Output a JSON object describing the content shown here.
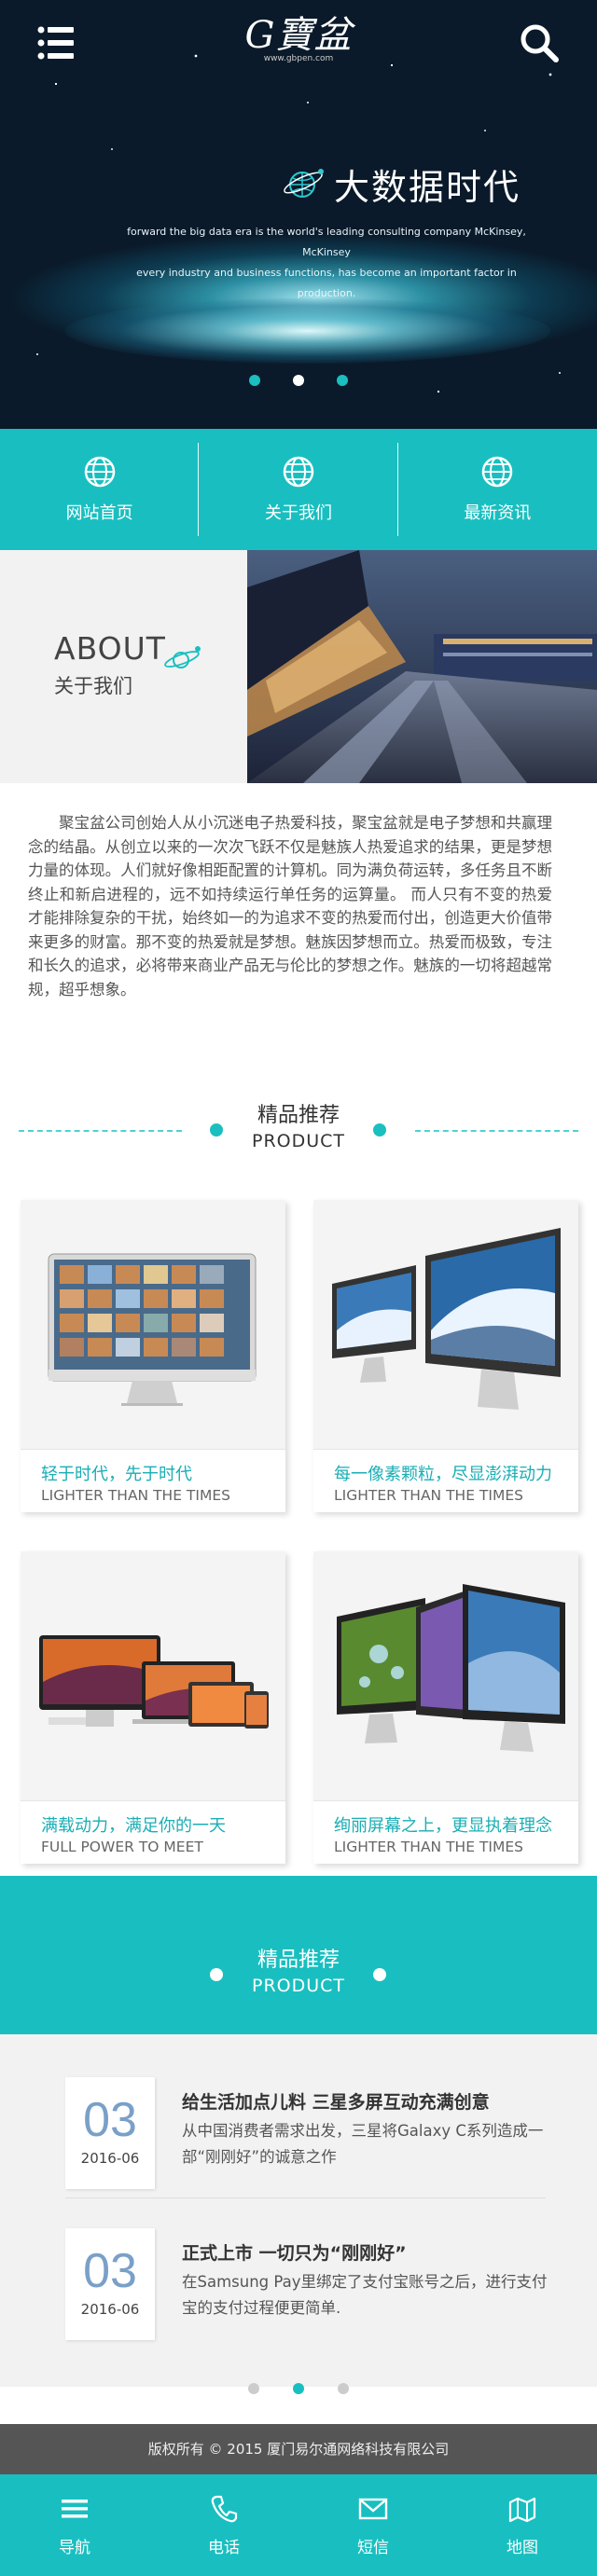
{
  "header": {
    "logo_text": "G寶盆",
    "logo_sub": "www.gbpen.com",
    "menu_icon": "menu-icon",
    "search_icon": "search-icon"
  },
  "hero": {
    "title": "大数据时代",
    "desc_line1": "forward the big data era is the world's leading consulting company McKinsey, McKinsey",
    "desc_line2": "every industry and business functions, has become an important factor in production.",
    "slides": 3,
    "active_slide": 1
  },
  "nav": {
    "items": [
      {
        "label": "网站首页",
        "icon": "globe-icon"
      },
      {
        "label": "关于我们",
        "icon": "globe-icon"
      },
      {
        "label": "最新资讯",
        "icon": "globe-icon"
      }
    ]
  },
  "about": {
    "title": "ABOUT",
    "subtitle": "关于我们",
    "text": "聚宝盆公司创始人从小沉迷电子热爱科技，聚宝盆就是电子梦想和共赢理念的结晶。从创立以来的一次次飞跃不仅是魅族人热爱追求的结果，更是梦想力量的体现。人们就好像相距配置的计算机。同为满负荷运转，多任务且不断终止和新启进程的，远不如持续运行单任务的运算量。 而人只有不变的热爱才能排除复杂的干扰，始终如一的为追求不变的热爱而付出，创造更大价值带来更多的财富。那不变的热爱就是梦想。魅族因梦想而立。热爱而极致，专注和长久的追求，必将带来商业产品无与伦比的梦想之作。魅族的一切将超越常规，超乎想象。"
  },
  "products_section": {
    "title_cn": "精品推荐",
    "title_en": "PRODUCT",
    "items": [
      {
        "title_cn": "轻于时代，先于时代",
        "title_en": "LIGHTER THAN THE TIMES",
        "image": "imac-front-image"
      },
      {
        "title_cn": "每一像素颗粒，尽显澎湃动力",
        "title_en": "LIGHTER THAN THE TIMES",
        "image": "imac-pair-image"
      },
      {
        "title_cn": "满载动力，满足你的一天",
        "title_en": "FULL POWER TO MEET",
        "image": "apple-devices-image"
      },
      {
        "title_cn": "绚丽屏幕之上，更显执着理念",
        "title_en": "LIGHTER THAN THE TIMES",
        "image": "imac-trio-image"
      }
    ]
  },
  "news_section": {
    "title_cn": "精品推荐",
    "title_en": "PRODUCT",
    "items": [
      {
        "day": "03",
        "ym": "2016-06",
        "title": "给生活加点儿料 三星多屏互动充满创意",
        "desc": "从中国消费者需求出发，三星将Galaxy C系列造成一部“刚刚好”的诚意之作"
      },
      {
        "day": "03",
        "ym": "2016-06",
        "title": "正式上市 一切只为“刚刚好”",
        "desc": "在Samsung Pay里绑定了支付宝账号之后，进行支付宝的支付过程便更简单."
      }
    ],
    "pages": 3,
    "active_page": 1
  },
  "footer": {
    "copyright": "版权所有 © 2015 厦门易尔通网络科技有限公司",
    "tabs": [
      {
        "label": "导航",
        "icon": "menu-icon"
      },
      {
        "label": "电话",
        "icon": "phone-icon"
      },
      {
        "label": "短信",
        "icon": "mail-icon"
      },
      {
        "label": "地图",
        "icon": "map-icon"
      }
    ]
  },
  "colors": {
    "accent": "#19bfc0",
    "date_blue": "#7aa0c8",
    "footer_gray": "#555555"
  }
}
